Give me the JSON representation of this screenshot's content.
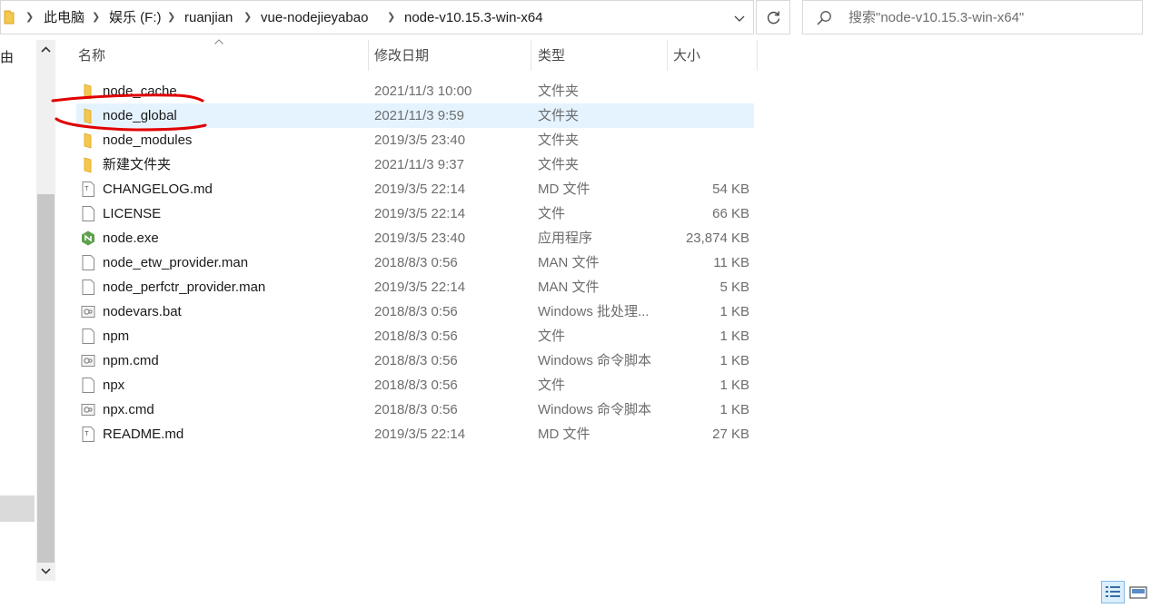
{
  "breadcrumb": {
    "items": [
      "此电脑",
      "娱乐 (F:)",
      "ruanjian",
      "vue-nodejieyabao",
      "node-v10.15.3-win-x64"
    ]
  },
  "search": {
    "placeholder": "搜索\"node-v10.15.3-win-x64\""
  },
  "nav": {
    "partial_label": "由"
  },
  "columns": {
    "name": "名称",
    "date": "修改日期",
    "type": "类型",
    "size": "大小"
  },
  "files": [
    {
      "name": "node_cache",
      "date": "2021/11/3 10:00",
      "type": "文件夹",
      "size": "",
      "icon": "folder-icon"
    },
    {
      "name": "node_global",
      "date": "2021/11/3 9:59",
      "type": "文件夹",
      "size": "",
      "icon": "folder-icon",
      "selected": true
    },
    {
      "name": "node_modules",
      "date": "2019/3/5 23:40",
      "type": "文件夹",
      "size": "",
      "icon": "folder-icon"
    },
    {
      "name": "新建文件夹",
      "date": "2021/11/3 9:37",
      "type": "文件夹",
      "size": "",
      "icon": "folder-icon"
    },
    {
      "name": "CHANGELOG.md",
      "date": "2019/3/5 22:14",
      "type": "MD 文件",
      "size": "54 KB",
      "icon": "text-file-icon"
    },
    {
      "name": "LICENSE",
      "date": "2019/3/5 22:14",
      "type": "文件",
      "size": "66 KB",
      "icon": "blank-file-icon"
    },
    {
      "name": "node.exe",
      "date": "2019/3/5 23:40",
      "type": "应用程序",
      "size": "23,874 KB",
      "icon": "node-exe-icon"
    },
    {
      "name": "node_etw_provider.man",
      "date": "2018/8/3 0:56",
      "type": "MAN 文件",
      "size": "11 KB",
      "icon": "blank-file-icon"
    },
    {
      "name": "node_perfctr_provider.man",
      "date": "2019/3/5 22:14",
      "type": "MAN 文件",
      "size": "5 KB",
      "icon": "blank-file-icon"
    },
    {
      "name": "nodevars.bat",
      "date": "2018/8/3 0:56",
      "type": "Windows 批处理...",
      "size": "1 KB",
      "icon": "script-file-icon"
    },
    {
      "name": "npm",
      "date": "2018/8/3 0:56",
      "type": "文件",
      "size": "1 KB",
      "icon": "blank-file-icon"
    },
    {
      "name": "npm.cmd",
      "date": "2018/8/3 0:56",
      "type": "Windows 命令脚本",
      "size": "1 KB",
      "icon": "script-file-icon"
    },
    {
      "name": "npx",
      "date": "2018/8/3 0:56",
      "type": "文件",
      "size": "1 KB",
      "icon": "blank-file-icon"
    },
    {
      "name": "npx.cmd",
      "date": "2018/8/3 0:56",
      "type": "Windows 命令脚本",
      "size": "1 KB",
      "icon": "script-file-icon"
    },
    {
      "name": "README.md",
      "date": "2019/3/5 22:14",
      "type": "MD 文件",
      "size": "27 KB",
      "icon": "text-file-icon"
    }
  ],
  "colors": {
    "selection": "#e5f3ff",
    "folder": "#f5c84c",
    "annotation": "#e00000",
    "node_green": "#5fa04e"
  }
}
